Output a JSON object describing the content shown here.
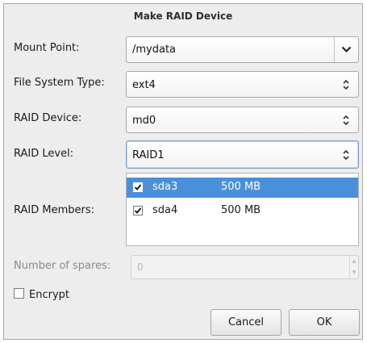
{
  "dialog": {
    "title": "Make RAID Device"
  },
  "mount_point": {
    "label": "Mount Point:",
    "value": "/mydata"
  },
  "fs_type": {
    "label": "File System Type:",
    "value": "ext4"
  },
  "raid_device": {
    "label": "RAID Device:",
    "value": "md0"
  },
  "raid_level": {
    "label": "RAID Level:",
    "value": "RAID1"
  },
  "raid_members": {
    "label": "RAID Members:",
    "items": [
      {
        "device": "sda3",
        "size": "500 MB",
        "checked": true,
        "selected": true
      },
      {
        "device": "sda4",
        "size": "500 MB",
        "checked": true,
        "selected": false
      }
    ]
  },
  "spares": {
    "label": "Number of spares:",
    "value": "0"
  },
  "encrypt": {
    "label": "Encrypt",
    "checked": false
  },
  "buttons": {
    "cancel": "Cancel",
    "ok": "OK"
  },
  "icons": {
    "dropdown": "chevron-down-icon",
    "combo": "updown-arrows-icon",
    "check": "check-icon"
  },
  "colors": {
    "selection": "#4a90d9",
    "dialog_bg": "#ededed"
  }
}
